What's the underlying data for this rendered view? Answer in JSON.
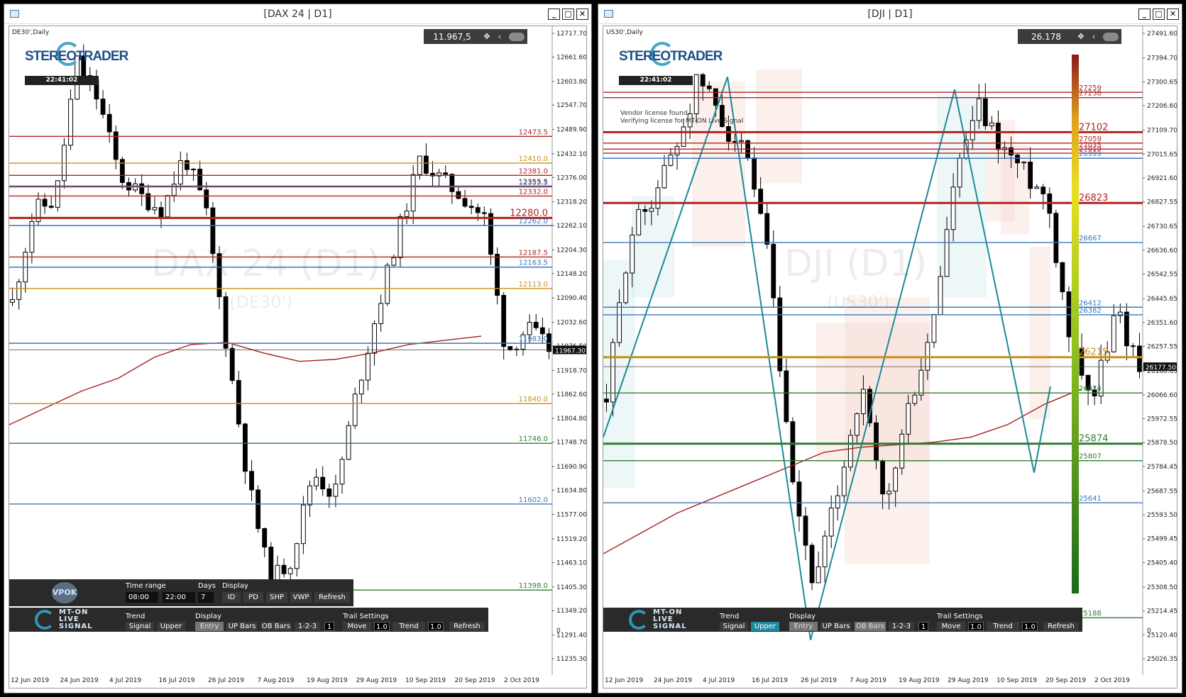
{
  "left": {
    "window_title": "[DAX 24 | D1]",
    "symbol_label": "DE30',Daily",
    "logo_text": "STEREOTRADER",
    "clock": "22:41:02",
    "price_display": "11.967,5",
    "watermark_main": "DAX 24 (D1)",
    "watermark_sub": "(DE30')",
    "current_price_tag": "11967.30",
    "y_ticks": [
      "12717.70",
      "12661.60",
      "12603.80",
      "12547.70",
      "12489.90",
      "12432.10",
      "12376.00",
      "12318.20",
      "12262.10",
      "12204.30",
      "12148.20",
      "12090.40",
      "12032.60",
      "11976.50",
      "11918.70",
      "11862.60",
      "11804.80",
      "11748.70",
      "11690.90",
      "11634.80",
      "11577.00",
      "11519.20",
      "11463.10",
      "11405.30",
      "11349.20",
      "11291.40",
      "11235.30"
    ],
    "y_zero": "0",
    "x_ticks": [
      "12 Jun 2019",
      "24 Jun 2019",
      "4 Jul 2019",
      "16 Jul 2019",
      "26 Jul 2019",
      "7 Aug 2019",
      "19 Aug 2019",
      "29 Aug 2019",
      "10 Sep 2019",
      "20 Sep 2019",
      "2 Oct 2019"
    ],
    "levels": [
      {
        "value": "12473.5",
        "color": "#b22222",
        "big": false
      },
      {
        "value": "12410.0",
        "color": "#c8901a",
        "big": false
      },
      {
        "value": "12381.0",
        "color": "#b22222",
        "big": false
      },
      {
        "value": "12355.5",
        "color": "#b22222",
        "big": false
      },
      {
        "value": "12353.5",
        "color": "#3a78b8",
        "big": false
      },
      {
        "value": "12332.0",
        "color": "#b22222",
        "big": false
      },
      {
        "value": "12280.0",
        "color": "#b22222",
        "big": true
      },
      {
        "value": "12262.0",
        "color": "#3a78b8",
        "big": false
      },
      {
        "value": "12187.5",
        "color": "#b22222",
        "big": false
      },
      {
        "value": "12163.5",
        "color": "#3a78b8",
        "big": false
      },
      {
        "value": "12113.0",
        "color": "#c8901a",
        "big": false
      },
      {
        "value": "11983.0",
        "color": "#3a78b8",
        "big": false
      },
      {
        "value": "11840.0",
        "color": "#c8901a",
        "big": false
      },
      {
        "value": "11746.0",
        "color": "#2e7d32",
        "big": false
      },
      {
        "value": "11602.0",
        "color": "#3a78b8",
        "big": false
      },
      {
        "value": "11398.0",
        "color": "#2e7d32",
        "big": false
      }
    ],
    "vpok": {
      "logo": "VPOK",
      "time_range_label": "Time range",
      "time_from": "08:00",
      "time_to": "22:00",
      "days_label": "Days",
      "days_value": "7",
      "display_label": "Display",
      "buttons": [
        "ID",
        "PD",
        "SHP",
        "VWP",
        "Refresh"
      ]
    }
  },
  "right": {
    "window_title": "[DJI | D1]",
    "symbol_label": "US30',Daily",
    "logo_text": "STEREOTRADER",
    "clock": "22:41:02",
    "price_display": "26.178",
    "watermark_main": "DJI (D1)",
    "watermark_sub": "(US30')",
    "current_price_tag": "26177.50",
    "vendor_line1": "Vendor license found.",
    "vendor_line2": "Verifying license for MT-ON Live Signal",
    "y_ticks": [
      "27491.60",
      "27394.70",
      "27300.65",
      "27206.60",
      "27109.70",
      "27015.65",
      "26921.60",
      "26827.55",
      "26730.65",
      "26636.60",
      "26542.55",
      "26445.65",
      "26351.60",
      "26257.55",
      "26160.65",
      "26066.60",
      "25972.55",
      "25878.50",
      "25784.45",
      "25687.55",
      "25593.50",
      "25499.45",
      "25405.40",
      "25308.50",
      "25214.45",
      "25120.40",
      "25026.35"
    ],
    "y_zero": "0",
    "x_ticks": [
      "12 Jun 2019",
      "24 Jun 2019",
      "4 Jul 2019",
      "16 Jul 2019",
      "26 Jul 2019",
      "7 Aug 2019",
      "19 Aug 2019",
      "29 Aug 2019",
      "10 Sep 2019",
      "20 Sep 2019",
      "2 Oct 2019"
    ],
    "levels": [
      {
        "value": "27259",
        "color": "#b22222",
        "big": false
      },
      {
        "value": "27238",
        "color": "#b22222",
        "big": false
      },
      {
        "value": "27102",
        "color": "#b22222",
        "big": true
      },
      {
        "value": "27059",
        "color": "#b22222",
        "big": false
      },
      {
        "value": "27035",
        "color": "#b22222",
        "big": false
      },
      {
        "value": "27019",
        "color": "#b22222",
        "big": false
      },
      {
        "value": "26999",
        "color": "#3a78b8",
        "big": false
      },
      {
        "value": "26823",
        "color": "#b22222",
        "big": true
      },
      {
        "value": "26667",
        "color": "#3a78b8",
        "big": false
      },
      {
        "value": "26412",
        "color": "#3a78b8",
        "big": false
      },
      {
        "value": "26382",
        "color": "#3a78b8",
        "big": false
      },
      {
        "value": "26215",
        "color": "#c8901a",
        "big": true
      },
      {
        "value": "26074",
        "color": "#2e7d32",
        "big": false
      },
      {
        "value": "25874",
        "color": "#2e7d32",
        "big": true
      },
      {
        "value": "25807",
        "color": "#2e7d32",
        "big": false
      },
      {
        "value": "25641",
        "color": "#3a78b8",
        "big": false
      },
      {
        "value": "25188",
        "color": "#2e7d32",
        "big": false
      }
    ]
  },
  "trail_panel": {
    "logo_text": [
      "MT-ON",
      "LIVE",
      "SIGNAL"
    ],
    "trend_label": "Trend",
    "trend_buttons": [
      "Signal",
      "Upper"
    ],
    "display_label": "Display",
    "display_buttons": [
      "Entry",
      "UP Bars",
      "OB Bars",
      "1-2-3"
    ],
    "display_num": "1",
    "trail_label": "Trail Settings",
    "move_label": "Move",
    "move_value": "1.0",
    "trend2_label": "Trend",
    "trend2_value": "1.0",
    "refresh_label": "Refresh"
  },
  "colors": {
    "resistance": "#b22222",
    "support": "#2e7d32",
    "pivot": "#c8901a",
    "neutral": "#3a78b8",
    "ma": "#a52020",
    "zigzag": "#1b8a99",
    "panel_bg": "#2a2a2a",
    "accent": "#1f8aa0"
  },
  "window_controls": [
    "_",
    "□",
    "✕"
  ]
}
